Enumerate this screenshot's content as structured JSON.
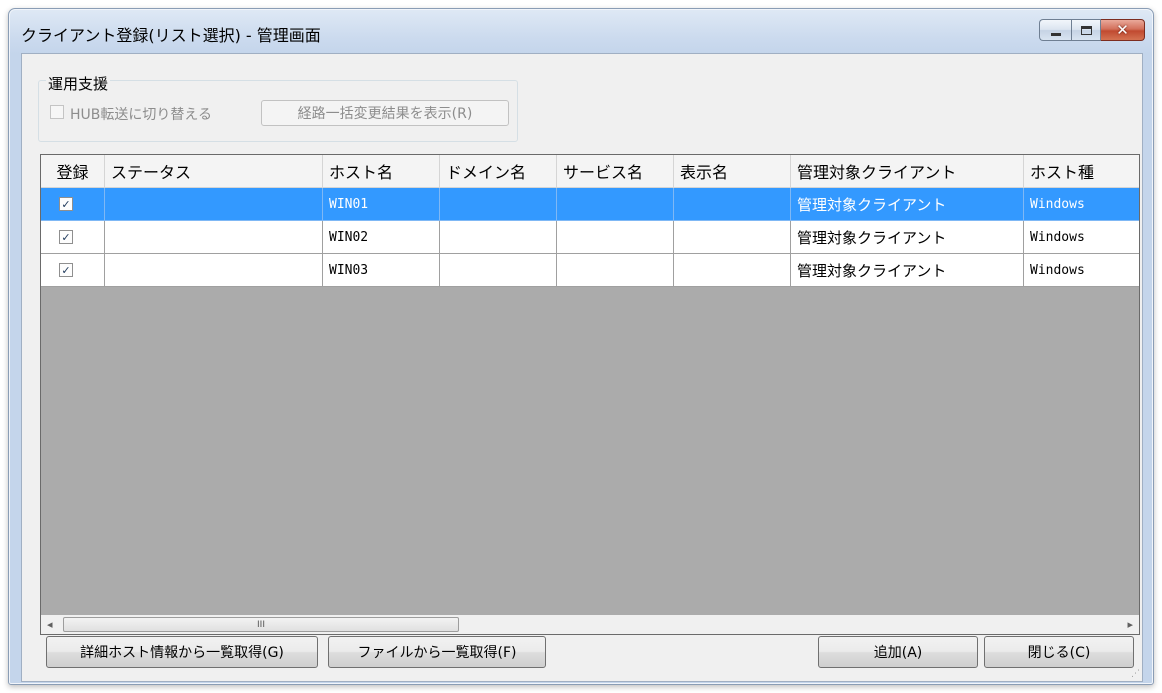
{
  "window": {
    "title": "クライアント登録(リスト選択) - 管理画面"
  },
  "operation_support": {
    "group_label": "運用支援",
    "hub_transfer_label": "HUB転送に切り替える",
    "route_button_label": "経路一括変更結果を表示(R)"
  },
  "table": {
    "headers": [
      "登録",
      "ステータス",
      "ホスト名",
      "ドメイン名",
      "サービス名",
      "表示名",
      "管理対象クライアント",
      "ホスト種"
    ],
    "rows": [
      {
        "registered": "✓",
        "status": "",
        "host": "WIN01",
        "domain": "",
        "service": "",
        "display": "",
        "managed": "管理対象クライアント",
        "host_type": "Windows"
      },
      {
        "registered": "✓",
        "status": "",
        "host": "WIN02",
        "domain": "",
        "service": "",
        "display": "",
        "managed": "管理対象クライアント",
        "host_type": "Windows"
      },
      {
        "registered": "✓",
        "status": "",
        "host": "WIN03",
        "domain": "",
        "service": "",
        "display": "",
        "managed": "管理対象クライアント",
        "host_type": "Windows"
      }
    ],
    "scroll_thumb_glyph": "III",
    "scroll_left_arrow": "◂",
    "scroll_right_arrow": "▸"
  },
  "buttons": {
    "detail_host": "詳細ホスト情報から一覧取得(G)",
    "from_file": "ファイルから一覧取得(F)",
    "add": "追加(A)",
    "close": "閉じる(C)"
  },
  "title_buttons": {
    "minimize": "▁",
    "maximize": "▣",
    "close": "✕"
  },
  "colors": {
    "selection": "#3399ff",
    "grid_background": "#ababab"
  }
}
